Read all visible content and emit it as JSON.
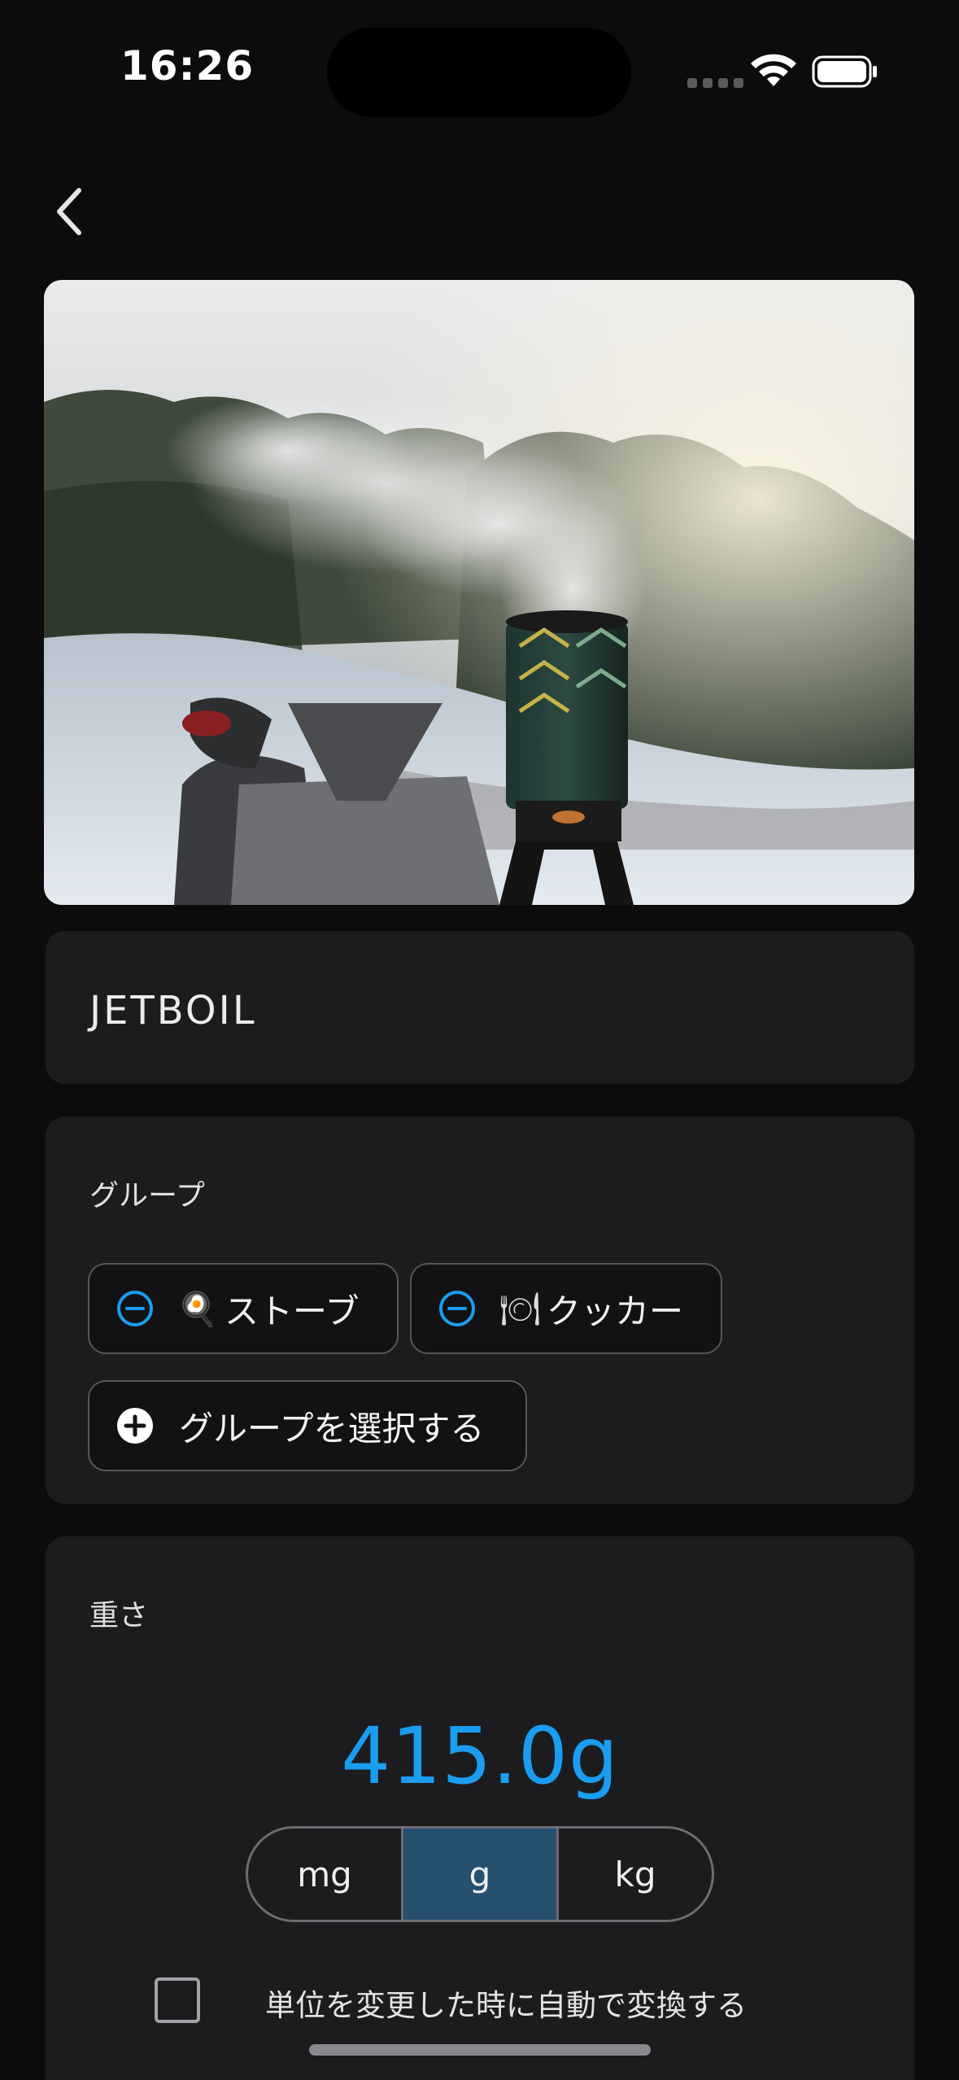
{
  "status_bar": {
    "time": "16:26",
    "icons": [
      "cellular-dots-icon",
      "wifi-icon",
      "battery-icon"
    ]
  },
  "nav": {
    "back_icon": "chevron-left-icon"
  },
  "item": {
    "name": "JETBOIL",
    "photo_description_icon": "photo-image"
  },
  "group": {
    "label": "グループ",
    "chips": [
      {
        "emoji": "🍳",
        "label": "ストーブ",
        "icon": "minus-circle-icon"
      },
      {
        "emoji": "🍽",
        "label": "クッカー",
        "icon": "minus-circle-icon"
      }
    ],
    "add_button": {
      "label": "グループを選択する",
      "icon": "plus-circle-icon"
    }
  },
  "weight": {
    "label": "重さ",
    "value": "415.0g",
    "units": [
      "mg",
      "g",
      "kg"
    ],
    "selected_unit": "g",
    "auto_convert_label": "単位を変更した時に自動で変換する",
    "auto_convert_checked": false
  },
  "colors": {
    "accent": "#1a9df0",
    "selected_segment": "#25506f",
    "card_bg": "#1c1c1e",
    "background": "#0c0c0d"
  }
}
